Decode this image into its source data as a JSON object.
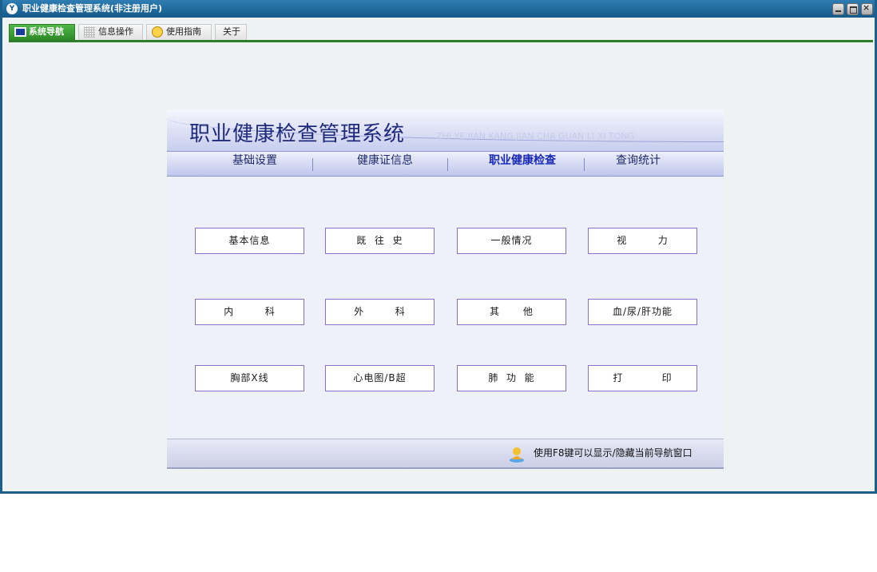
{
  "window": {
    "title": "职业健康检查管理系统(非注册用户)",
    "icon_label": "Y"
  },
  "tabs": [
    {
      "label": "系统导航",
      "active": true
    },
    {
      "label": "信息操作",
      "active": false
    },
    {
      "label": "使用指南",
      "active": false
    },
    {
      "label": "关于",
      "active": false
    }
  ],
  "banner": {
    "title": "职业健康检查管理系统",
    "subtitle": "ZHI YE JIAN KANG JIAN CHA GUAN LI XI TONG"
  },
  "nav": {
    "items": [
      {
        "label": "基础设置"
      },
      {
        "label": "健康证信息"
      },
      {
        "label": "职业健康检查",
        "active": true
      },
      {
        "label": "查询统计"
      }
    ]
  },
  "buttons": [
    {
      "label": "基本信息"
    },
    {
      "label": "既  往  史"
    },
    {
      "label": "一般情况"
    },
    {
      "label": "视        力"
    },
    {
      "label": "内        科"
    },
    {
      "label": "外        科"
    },
    {
      "label": "其      他"
    },
    {
      "label": "血/尿/肝功能"
    },
    {
      "label": "胸部X线"
    },
    {
      "label": "心电图/B超"
    },
    {
      "label": "肺  功  能"
    },
    {
      "label": "打          印"
    }
  ],
  "footer": {
    "hint": "使用F8键可以显示/隐藏当前导航窗口"
  },
  "colors": {
    "title_bar": "#145a8a",
    "active_tab": "#2d8a27",
    "button_border": "#8b6fc9",
    "active_nav_text": "#1a2ab8"
  }
}
